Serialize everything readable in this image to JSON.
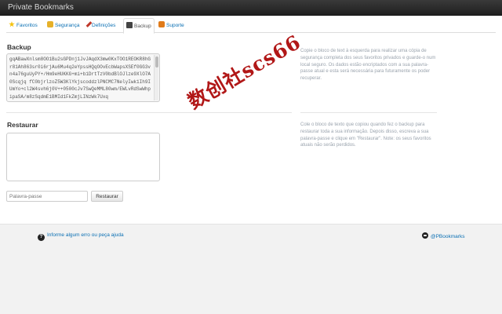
{
  "app": {
    "title": "Private Bookmarks"
  },
  "tabs": [
    {
      "label": "Favoritos",
      "icon": "star-icon"
    },
    {
      "label": "Segurança",
      "icon": "lock-icon"
    },
    {
      "label": "Definições",
      "icon": "tools-icon"
    },
    {
      "label": "Backup",
      "icon": "backup-icon",
      "active": true
    },
    {
      "label": "Suporte",
      "icon": "support-icon"
    }
  ],
  "backup": {
    "title": "Backup",
    "data": "gqABawXnlsm8OO1Bu2sGPDnj1JvJAqdX3mw0KxTOO1REOKR8hGr81Ah863sr0i6rjAu6Mu4q2eYpssHQqOOvEcbWapsXSEf0GG3vn4a76guUyPY+/Hm9eHUKKG+mi+b1DrtTzV0bdBlOJlze9XlO7A0Scqjq fC0bjrlzoZ5W3KlYkjscoddzlPNCMC7NelyIwk1Ih9IUmYo+cl2W4svh6j0V++0500cJv7SwQeMML80wm/EWLvRdSwWhpipaSA/m8zSqdmE1BMId1FkZmjLINzWk7Uxq",
    "help": "Copie o bloco de text à esquerda para realizar uma cópia de segurança completa dos seus favoritos privados e guarde-o num local seguro. Os dados estão encriptados com a sua palavra-passe atual e esta será necessária para futuramente os poder recuperar."
  },
  "restore": {
    "title": "Restaurar",
    "help": "Cole o bloco de texto que copiou quando fez o backup para restaurar toda a sua informação. Depois disso, escreva a sua palavra-passe e clique em \"Restaurar\". Note: os seus favoritos atuais não serão perdidos.",
    "password_placeholder": "Palavra-passe",
    "button_label": "Restaurar"
  },
  "footer": {
    "help_link": "Informe algum erro ou peça ajuda",
    "twitter_link": "@PBookmarks"
  },
  "watermark": {
    "text": "数创社scs66",
    "color": "#b11717"
  },
  "colors": {
    "link": "#0a6fb3",
    "topbar": "#2b2b2b",
    "footer_bg": "#f2f2f2"
  }
}
